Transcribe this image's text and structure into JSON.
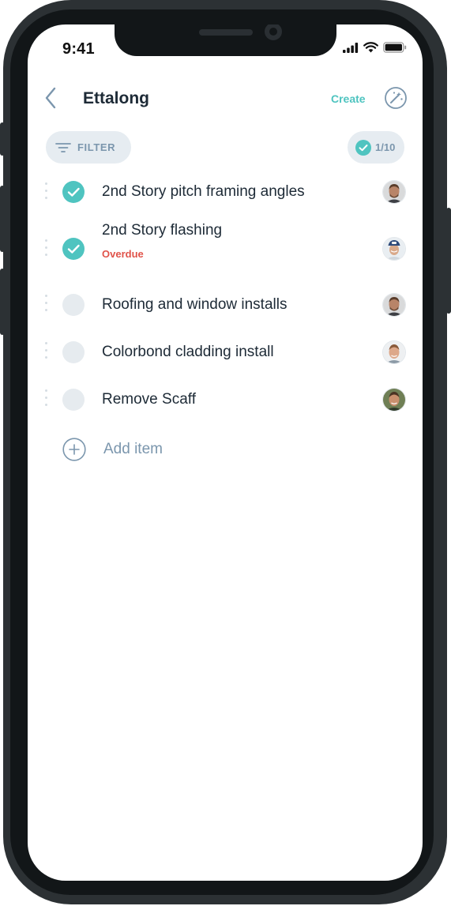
{
  "status_bar": {
    "time": "9:41"
  },
  "header": {
    "title": "Ettalong",
    "create_label": "Create"
  },
  "filter": {
    "label": "FILTER"
  },
  "progress": {
    "label": "1/10",
    "completed": 1,
    "total": 10
  },
  "tasks": [
    {
      "title": "2nd Story pitch framing angles",
      "done": true,
      "note": ""
    },
    {
      "title": "2nd Story flashing",
      "done": true,
      "note": "Overdue"
    },
    {
      "title": "Roofing and window installs",
      "done": false,
      "note": ""
    },
    {
      "title": "Colorbond cladding install",
      "done": false,
      "note": ""
    },
    {
      "title": "Remove Scaff",
      "done": false,
      "note": ""
    }
  ],
  "add_item": {
    "label": "Add item"
  },
  "colors": {
    "accent": "#4fc4c0",
    "overdue": "#e0534a",
    "muted": "#7b96ad",
    "text": "#1d2a36"
  }
}
